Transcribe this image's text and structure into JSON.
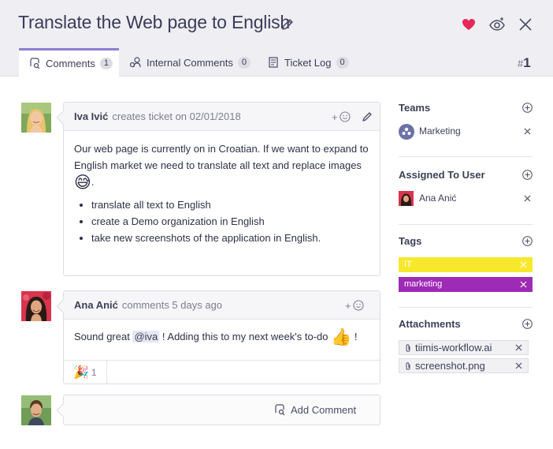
{
  "header": {
    "title": "Translate the Web page to English",
    "ticket_hash": "#",
    "ticket_number": "1"
  },
  "tabs": [
    {
      "label": "Comments",
      "count": "1"
    },
    {
      "label": "Internal Comments",
      "count": "0"
    },
    {
      "label": "Ticket Log",
      "count": "0"
    }
  ],
  "comments": [
    {
      "author": "Iva Ivić",
      "meta": "creates ticket on 02/01/2018",
      "paragraph": "Our web page is currently on in Croatian. If we want to expand to English market we need to translate all text and replace images",
      "emoji": "😅",
      "trailing": ".",
      "bullets": [
        "translate all text to English",
        "create a Demo organization in English",
        "take new screenshots of the application in English."
      ]
    },
    {
      "author": "Ana Anić",
      "meta": "comments 5 days ago",
      "text_before": "Sound great ",
      "mention": "@iva",
      "text_after": " ! Adding this to my next week's to-do ",
      "emoji": "👍",
      "text_end": " !",
      "reaction_emoji": "🎉",
      "reaction_count": "1"
    }
  ],
  "add_comment": {
    "label": "Add Comment"
  },
  "sidebar": {
    "teams": {
      "title": "Teams",
      "items": [
        "Marketing"
      ]
    },
    "assigned": {
      "title": "Assigned To User",
      "items": [
        "Ana Anić"
      ]
    },
    "tags": {
      "title": "Tags",
      "items": [
        {
          "label": "IT",
          "bg": "#f7e82e",
          "fg": "#ffffff"
        },
        {
          "label": "marketing",
          "bg": "#9e2bb5",
          "fg": "#ffffff"
        }
      ]
    },
    "attachments": {
      "title": "Attachments",
      "items": [
        "tiimis-workflow.ai",
        "screenshot.png"
      ]
    }
  },
  "colors": {
    "accent": "#8a7fd0",
    "heart": "#e8285a",
    "header_bg": "#eeeef3"
  }
}
